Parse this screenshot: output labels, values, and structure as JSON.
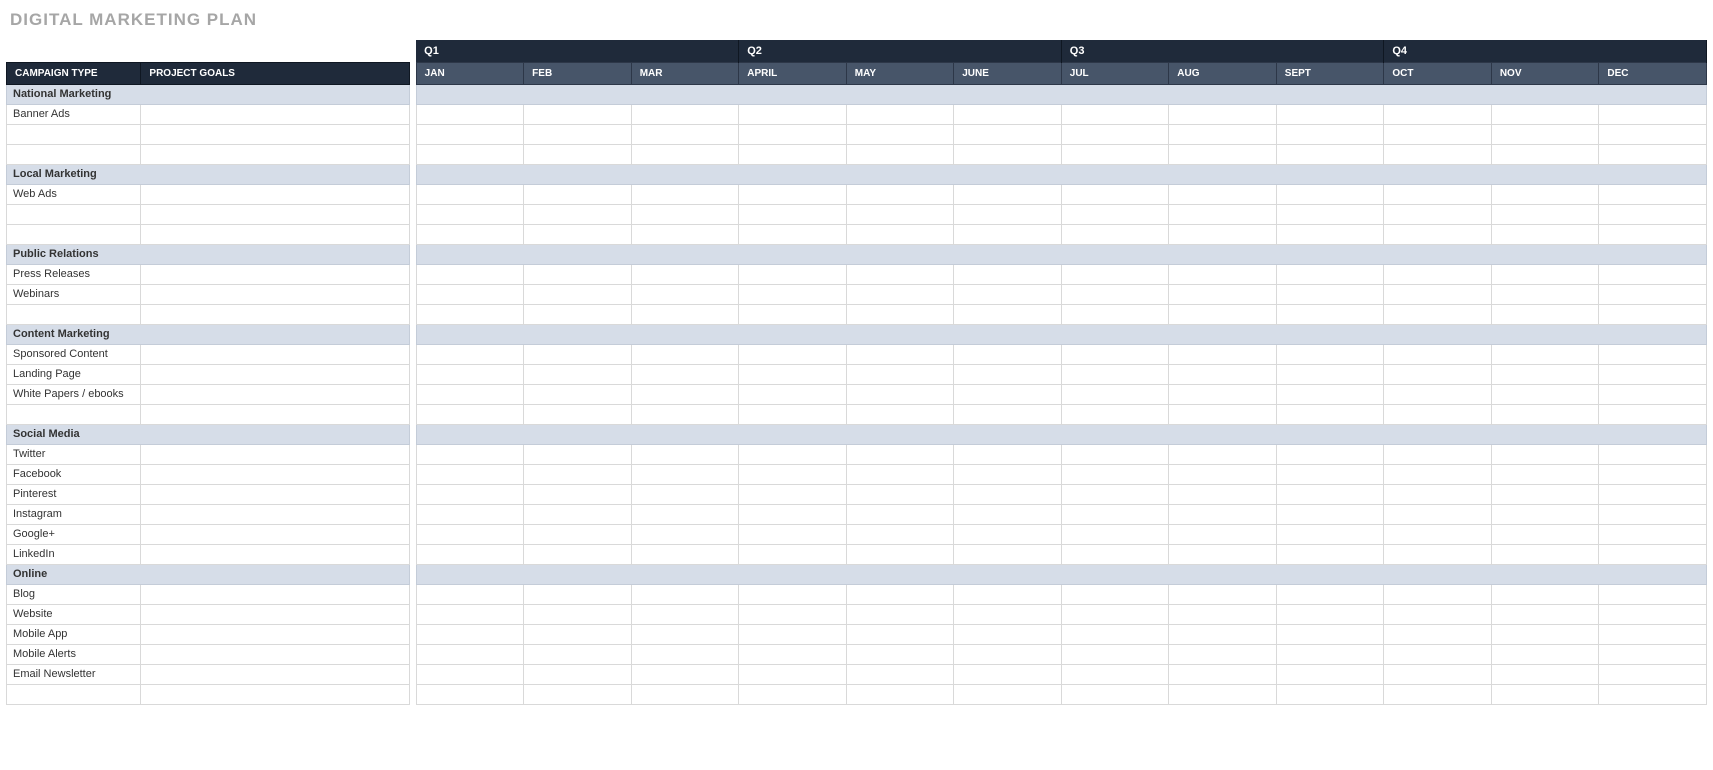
{
  "title": "DIGITAL MARKETING PLAN",
  "headers": {
    "campaign_type": "CAMPAIGN TYPE",
    "project_goals": "PROJECT GOALS"
  },
  "quarters": [
    "Q1",
    "Q2",
    "Q3",
    "Q4"
  ],
  "months": [
    "JAN",
    "FEB",
    "MAR",
    "APRIL",
    "MAY",
    "JUNE",
    "JUL",
    "AUG",
    "SEPT",
    "OCT",
    "NOV",
    "DEC"
  ],
  "sections": [
    {
      "name": "National Marketing",
      "rows": [
        "Banner Ads",
        "",
        ""
      ]
    },
    {
      "name": "Local Marketing",
      "rows": [
        "Web Ads",
        "",
        ""
      ]
    },
    {
      "name": "Public Relations",
      "rows": [
        "Press Releases",
        "Webinars",
        ""
      ]
    },
    {
      "name": "Content Marketing",
      "rows": [
        "Sponsored Content",
        "Landing Page",
        "White Papers / ebooks",
        ""
      ]
    },
    {
      "name": "Social Media",
      "rows": [
        "Twitter",
        "Facebook",
        "Pinterest",
        "Instagram",
        "Google+",
        "LinkedIn"
      ]
    },
    {
      "name": "Online",
      "rows": [
        "Blog",
        "Website",
        "Mobile App",
        "Mobile Alerts",
        "Email Newsletter",
        ""
      ]
    }
  ]
}
